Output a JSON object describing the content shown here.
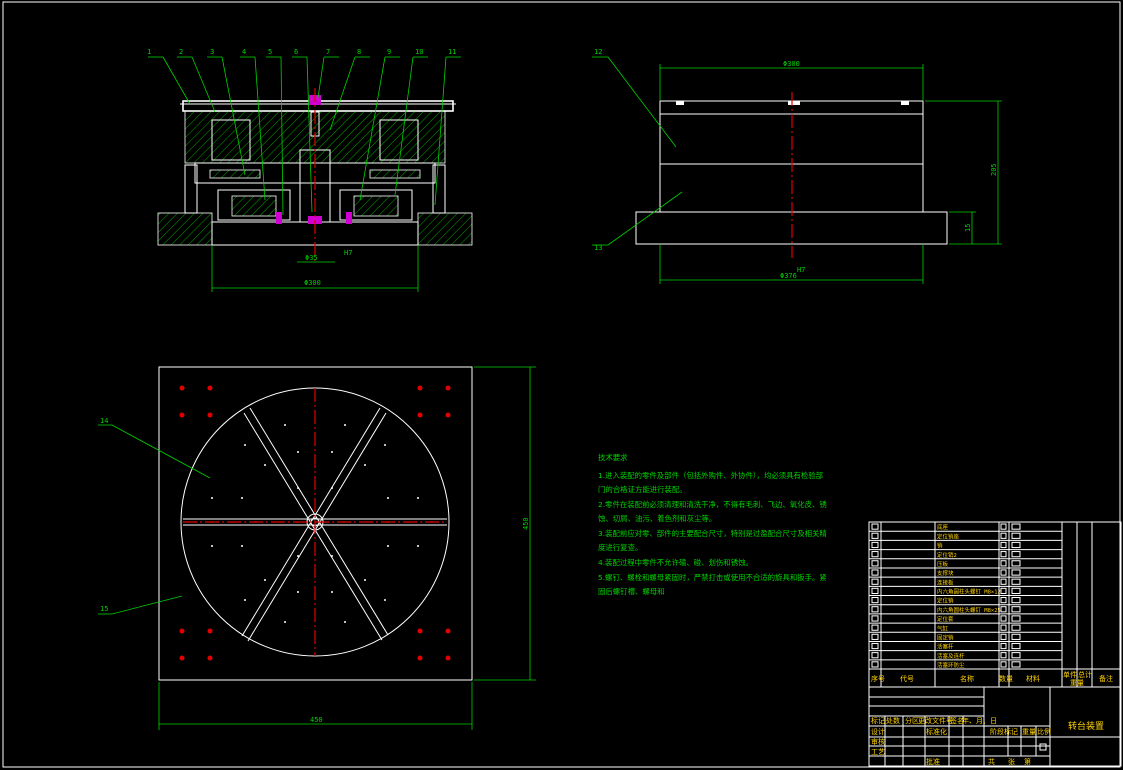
{
  "drawing": {
    "part_numbers": [
      "1",
      "2",
      "3",
      "4",
      "5",
      "6",
      "7",
      "8",
      "9",
      "10",
      "11"
    ],
    "side_part_numbers": [
      "12",
      "13"
    ],
    "plan_part_numbers": [
      "14",
      "15"
    ],
    "dims": {
      "front_bore": "Φ35",
      "front_bore_tol": "H7",
      "front_width": "Φ300",
      "side_top": "Φ300",
      "side_bottom": "Φ376",
      "side_bottom_tol": "H7",
      "side_height": "205",
      "side_base": "15",
      "plan_width": "450",
      "plan_height": "450"
    },
    "notes_title": "技术要求",
    "notes": [
      "1.进入装配的零件及部件（包括外购件、外协件），均必须具有检验部",
      "门的合格证方能进行装配。",
      "2.零件在装配前必须清理和清洗干净，不得有毛刺、飞边、氧化皮、锈",
      "蚀、切屑、油污、着色剂和灰尘等。",
      "3.装配前应对零、部件的主要配合尺寸，特别是过盈配合尺寸及相关精",
      "度进行复查。",
      "4.装配过程中零件不允许磕、碰、划伤和锈蚀。",
      "5.螺钉、螺栓和螺母紧固时，严禁打击或使用不合适的旋具和扳手。紧",
      "固后螺钉槽、螺母和"
    ],
    "bom_rows": [
      {
        "name": "底座",
        "spec": ""
      },
      {
        "name": "定位销座",
        "spec": ""
      },
      {
        "name": "销",
        "spec": ""
      },
      {
        "name": "定位销2",
        "spec": ""
      },
      {
        "name": "压板",
        "spec": ""
      },
      {
        "name": "支撑块",
        "spec": ""
      },
      {
        "name": "连接板",
        "spec": ""
      },
      {
        "name": "内六角圆柱头螺钉 M8×12",
        "spec": ""
      },
      {
        "name": "定位销",
        "spec": ""
      },
      {
        "name": "内六角圆柱头螺钉 M8×25",
        "spec": ""
      },
      {
        "name": "定位套",
        "spec": ""
      },
      {
        "name": "气缸",
        "spec": ""
      },
      {
        "name": "固定销",
        "spec": ""
      },
      {
        "name": "活塞杆",
        "spec": ""
      },
      {
        "name": "活塞及连杆",
        "spec": ""
      },
      {
        "name": "活塞环防尘",
        "spec": ""
      }
    ],
    "bom_header": {
      "seq": "序号",
      "code": "代号",
      "name": "名称",
      "qty": "数量",
      "material": "材料",
      "unit_weight": "单件",
      "total_weight": "总计",
      "weight": "重量",
      "remark": "备注"
    },
    "title_block": {
      "drawing_title": "转台装置",
      "mark": "标记",
      "count": "处数",
      "zone": "分区",
      "change_doc": "更改文件号",
      "signature": "签名",
      "date": "年、月、日",
      "designer": "设计",
      "standardize": "标准化",
      "stage_mark": "阶段标记",
      "weight": "重量",
      "scale": "比例",
      "review": "审核",
      "process": "工艺",
      "approve": "批准",
      "sheet_total": "共",
      "sheet": "张",
      "page": "第"
    }
  }
}
